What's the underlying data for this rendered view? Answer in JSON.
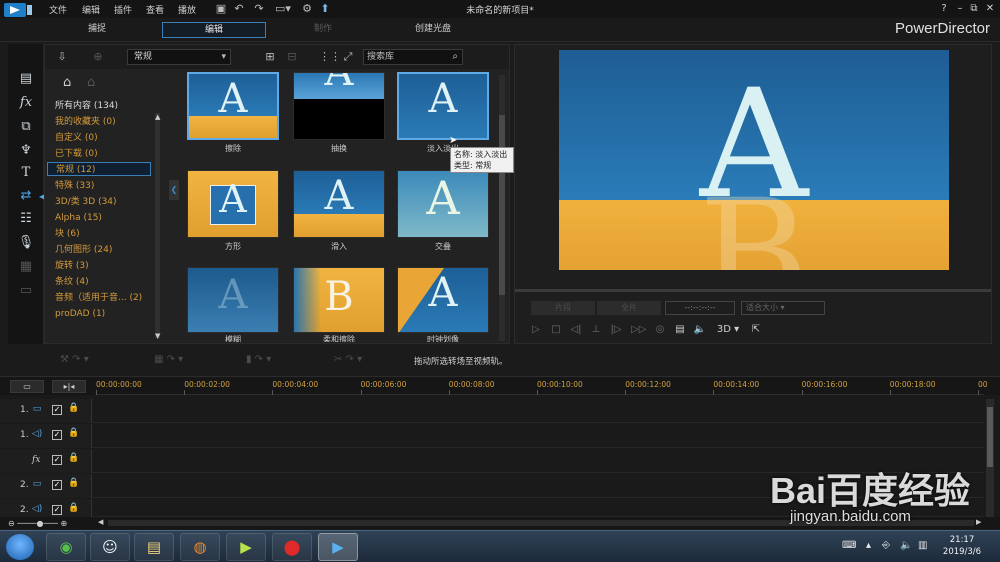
{
  "app": {
    "menus": [
      "文件",
      "编辑",
      "插件",
      "查看",
      "播放"
    ],
    "document_title": "未命名的新项目*",
    "brand": "PowerDirector",
    "window_buttons": [
      "?",
      "–",
      "⧉",
      "✕"
    ]
  },
  "modes": [
    {
      "label": "捕捉",
      "state": "normal"
    },
    {
      "label": "编辑",
      "state": "active"
    },
    {
      "label": "制作",
      "state": "disabled"
    },
    {
      "label": "创建光盘",
      "state": "normal"
    }
  ],
  "library": {
    "category_selected": "常规",
    "search_placeholder": "搜索库",
    "categories": [
      {
        "label": "所有内容 (134)",
        "color": "white"
      },
      {
        "label": "我的收藏夹 (0)",
        "color": "orange"
      },
      {
        "label": "自定义 (0)",
        "color": "orange"
      },
      {
        "label": "已下载 (0)",
        "color": "orange"
      },
      {
        "label": "常规 (12)",
        "color": "orange",
        "selected": true
      },
      {
        "label": "特殊 (33)",
        "color": "orange"
      },
      {
        "label": "3D/类 3D (34)",
        "color": "orange"
      },
      {
        "label": "Alpha (15)",
        "color": "orange"
      },
      {
        "label": "块 (6)",
        "color": "orange"
      },
      {
        "label": "几何图形 (24)",
        "color": "orange"
      },
      {
        "label": "旋转 (3)",
        "color": "orange"
      },
      {
        "label": "条纹 (4)",
        "color": "orange"
      },
      {
        "label": "音频（适用于音... (2)",
        "color": "orange"
      },
      {
        "label": "proDAD (1)",
        "color": "orange"
      }
    ],
    "thumbnails": [
      {
        "label": "擦除"
      },
      {
        "label": "抽换"
      },
      {
        "label": "淡入淡出",
        "selected": true
      },
      {
        "label": "方形"
      },
      {
        "label": "滑入"
      },
      {
        "label": "交叠"
      },
      {
        "label": "模糊"
      },
      {
        "label": "柔和擦除"
      },
      {
        "label": "时钟划像"
      }
    ],
    "tooltip": {
      "name": "名称: 淡入淡出",
      "type": "类型: 常规"
    }
  },
  "preview": {
    "clip_button": "片段",
    "movie_button": "全片",
    "timecode": "--:--:--:--",
    "fit_size": "适合大小",
    "three_d": "3D"
  },
  "edit_toolbar": {
    "hint": "拖动所选转场至视频轨。"
  },
  "timeline": {
    "ruler": [
      "00:00:00:00",
      "00:00:02:00",
      "00:00:04:00",
      "00:00:06:00",
      "00:00:08:00",
      "00:00:10:00",
      "00:00:12:00",
      "00:00:14:00",
      "00:00:16:00",
      "00:00:18:00",
      "00"
    ],
    "tracks": [
      {
        "num": "1.",
        "kind": "video-icon"
      },
      {
        "num": "1.",
        "kind": "audio-icon"
      },
      {
        "num": "fx",
        "kind": "fx-icon"
      },
      {
        "num": "2.",
        "kind": "video-icon"
      },
      {
        "num": "2.",
        "kind": "audio-icon"
      }
    ]
  },
  "taskbar": {
    "time": "21:17",
    "date": "2019/3/6"
  },
  "watermark": {
    "brand": "Bai百度经验",
    "url": "jingyan.baidu.com"
  }
}
